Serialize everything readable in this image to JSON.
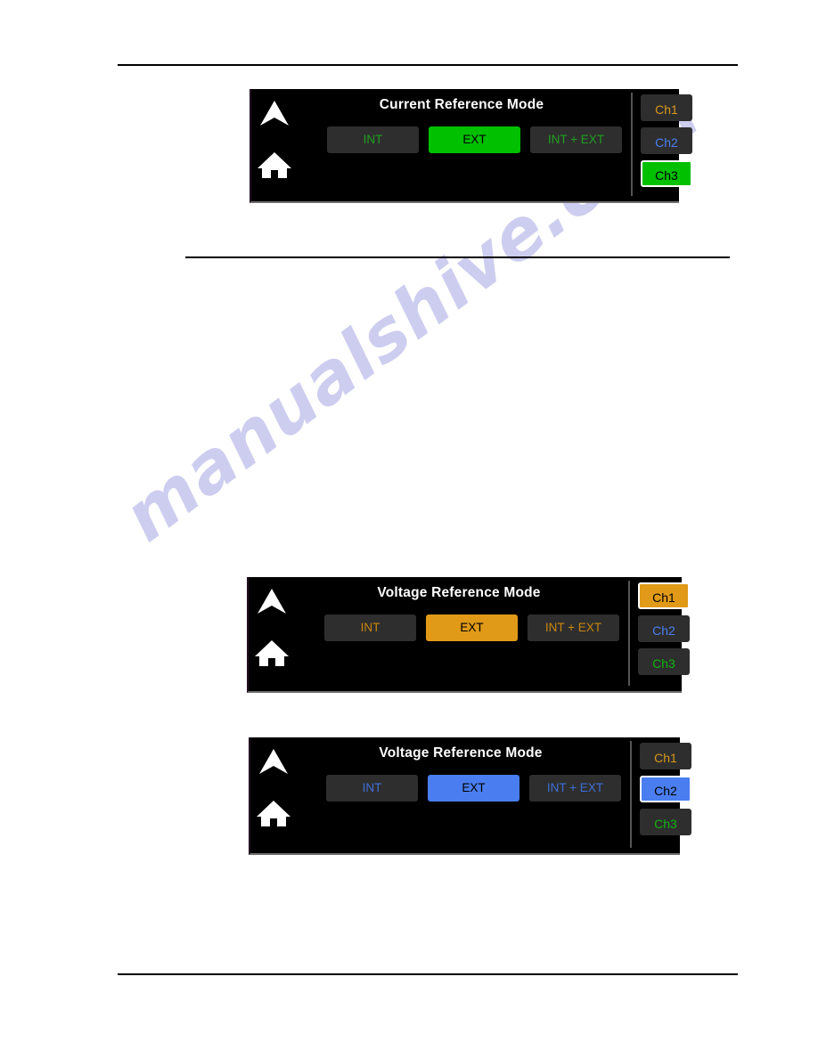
{
  "page": {
    "background": "#ffffff",
    "watermark_text": "manualshive.com",
    "watermark_color": "#c9c9ef",
    "rules": [
      "top-rule",
      "middle-rule",
      "bottom-rule"
    ]
  },
  "themes": {
    "green": {
      "accent": "#00c000",
      "text": "#1f9f1f",
      "on_accent": "#000000"
    },
    "orange": {
      "accent": "#e09a18",
      "text": "#c8860e",
      "on_accent": "#000000"
    },
    "blue": {
      "accent": "#4a7ef0",
      "text": "#3d6fd8",
      "on_accent": "#000000"
    }
  },
  "channel_colors": {
    "ch1": "#d9971a",
    "ch2": "#4a7ef0",
    "ch3": "#11b411"
  },
  "panels": [
    {
      "id": "panel-current-reference-mode",
      "title": "Current Reference Mode",
      "theme": "green",
      "nav": {
        "up_icon": "up-arrow-icon",
        "home_icon": "home-icon"
      },
      "modes": [
        {
          "label": "INT",
          "selected": false
        },
        {
          "label": "EXT",
          "selected": true
        },
        {
          "label": "INT + EXT",
          "selected": false
        }
      ],
      "channels": [
        {
          "label": "Ch1",
          "selected": false
        },
        {
          "label": "Ch2",
          "selected": false
        },
        {
          "label": "Ch3",
          "selected": true
        }
      ]
    },
    {
      "id": "panel-voltage-reference-mode-ch1",
      "title": "Voltage Reference Mode",
      "theme": "orange",
      "nav": {
        "up_icon": "up-arrow-icon",
        "home_icon": "home-icon"
      },
      "modes": [
        {
          "label": "INT",
          "selected": false
        },
        {
          "label": "EXT",
          "selected": true
        },
        {
          "label": "INT + EXT",
          "selected": false
        }
      ],
      "channels": [
        {
          "label": "Ch1",
          "selected": true
        },
        {
          "label": "Ch2",
          "selected": false
        },
        {
          "label": "Ch3",
          "selected": false
        }
      ]
    },
    {
      "id": "panel-voltage-reference-mode-ch2",
      "title": "Voltage Reference Mode",
      "theme": "blue",
      "nav": {
        "up_icon": "up-arrow-icon",
        "home_icon": "home-icon"
      },
      "modes": [
        {
          "label": "INT",
          "selected": false
        },
        {
          "label": "EXT",
          "selected": true
        },
        {
          "label": "INT + EXT",
          "selected": false
        }
      ],
      "channels": [
        {
          "label": "Ch1",
          "selected": false
        },
        {
          "label": "Ch2",
          "selected": true
        },
        {
          "label": "Ch3",
          "selected": false
        }
      ]
    }
  ]
}
